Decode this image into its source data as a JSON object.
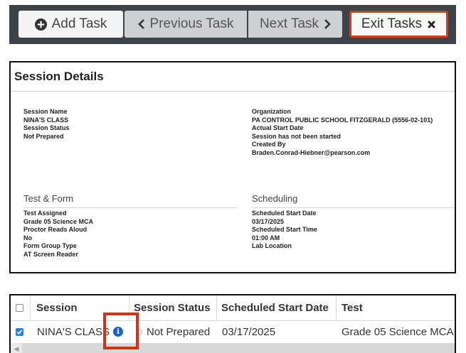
{
  "toolbar": {
    "add_task": "Add Task",
    "previous_task": "Previous Task",
    "next_task": "Next Task",
    "exit_tasks": "Exit Tasks"
  },
  "session_details": {
    "title": "Session Details",
    "left": {
      "session_name_label": "Session Name",
      "session_name_value": "NINA'S CLASS",
      "session_status_label": "Session Status",
      "session_status_value": "Not Prepared"
    },
    "right": {
      "organization_label": "Organization",
      "organization_value": "PA CONTROL PUBLIC SCHOOL FITZGERALD (5556-02-101)",
      "actual_start_label": "Actual Start Date",
      "actual_start_value": "Session has not been started",
      "created_by_label": "Created By",
      "created_by_value": "Braden.Conrad-Hiebner@pearson.com"
    },
    "test_form": {
      "title": "Test & Form",
      "test_assigned_label": "Test Assigned",
      "test_assigned_value": "Grade 05 Science MCA",
      "proctor_label": "Proctor Reads Aloud",
      "proctor_value": "No",
      "form_group_label": "Form Group Type",
      "form_group_value": "AT Screen Reader"
    },
    "scheduling": {
      "title": "Scheduling",
      "start_date_label": "Scheduled Start Date",
      "start_date_value": "03/17/2025",
      "start_time_label": "Scheduled Start Time",
      "start_time_value": "01:00 AM",
      "lab_location_label": "Lab Location"
    }
  },
  "session_table": {
    "columns": [
      "Session",
      "Session Status",
      "Scheduled Start Date",
      "Test"
    ],
    "rows": [
      {
        "checked": true,
        "session": "NINA'S CLASS",
        "status": "Not Prepared",
        "start_date": "03/17/2025",
        "test": "Grade 05 Science MCA"
      }
    ]
  },
  "colors": {
    "toolbar_bg": "#3e4349",
    "highlight": "#d1321d",
    "info_icon": "#1d64c0",
    "checkbox": "#2f7fd0"
  }
}
